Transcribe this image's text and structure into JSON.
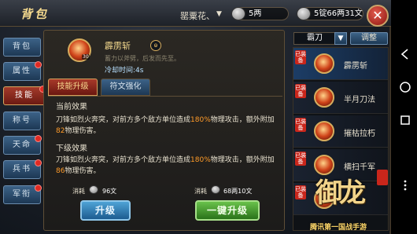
{
  "header": {
    "title": "背包",
    "player_name": "罂粟花、",
    "player_arrow": "▼",
    "silver": "5两",
    "gold": "5锭66两31文",
    "close": "✕"
  },
  "tabs": [
    {
      "label": "背包",
      "dot": false
    },
    {
      "label": "属性",
      "dot": true
    },
    {
      "label": "技能",
      "dot": true,
      "active": true
    },
    {
      "label": "称号",
      "dot": false
    },
    {
      "label": "天命",
      "dot": true
    },
    {
      "label": "兵书",
      "dot": true
    },
    {
      "label": "军衔",
      "dot": true
    }
  ],
  "skill": {
    "name": "霹雳斩",
    "level": "30",
    "description": "蓄力以斧劈，后发而先至。",
    "cooldown": "冷却时间:4s"
  },
  "subtabs": {
    "upgrade": "技能升级",
    "rune": "符文强化"
  },
  "current_effect": {
    "title": "当前效果",
    "text_before": "刀锋如烈火奔突，对前方多个敌方单位造成",
    "percent": "180%",
    "text_middle": "物理攻击，额外附加",
    "extra_value": "82",
    "text_after": "物理伤害。"
  },
  "next_effect": {
    "title": "下级效果",
    "text_before": "刀锋如烈火奔突，对前方多个敌方单位造成",
    "percent": "180%",
    "text_middle": "物理攻击，额外附加",
    "extra_value": "86",
    "text_after": "物理伤害。"
  },
  "costs": {
    "label": "消耗",
    "upgrade_cost": "96文",
    "oneclick_cost": "68两10文"
  },
  "buttons": {
    "upgrade": "升级",
    "oneclick": "一键升级"
  },
  "right_panel": {
    "weapon": "霸刀",
    "weapon_arrow": "▼",
    "adjust": "调整",
    "equipped_tag": "已装备",
    "items": [
      {
        "name": "霹雳斩",
        "equipped": true,
        "active": true
      },
      {
        "name": "半月刀法",
        "equipped": true,
        "active": false
      },
      {
        "name": "摧枯拉朽",
        "equipped": true,
        "active": false
      },
      {
        "name": "横扫千军",
        "equipped": true,
        "active": false
      },
      {
        "name": "",
        "equipped": true,
        "active": false
      }
    ]
  },
  "watermark": {
    "logo_text": "御龙",
    "slogan": "腾讯第一国战手游"
  },
  "icons": {
    "coin": "coin-icon",
    "close": "close-icon",
    "back": "back-icon",
    "home": "home-icon",
    "recents": "recents-icon",
    "menu": "menu-icon"
  },
  "colors": {
    "highlight": "#ff9b29",
    "gold_text": "#f3d88d"
  }
}
